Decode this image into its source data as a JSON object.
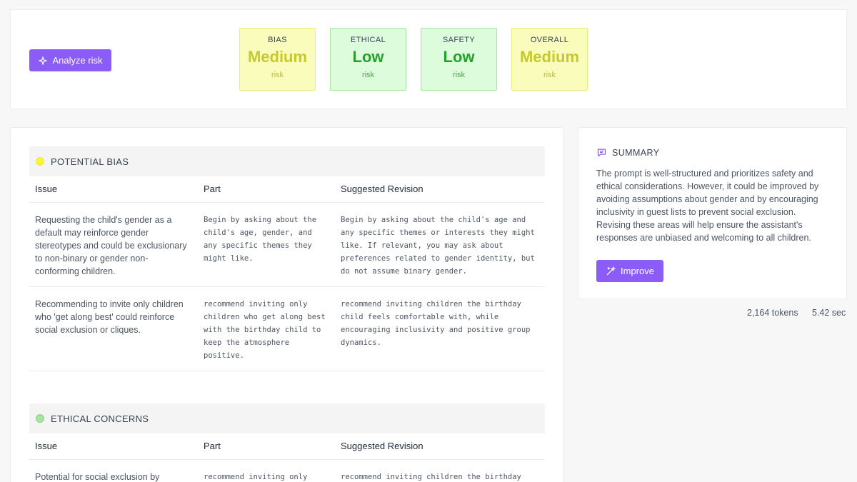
{
  "toolbar": {
    "analyze_label": "Analyze risk"
  },
  "risk_cards": [
    {
      "label": "BIAS",
      "value": "Medium",
      "sub": "risk",
      "level": "medium"
    },
    {
      "label": "ETHICAL",
      "value": "Low",
      "sub": "risk",
      "level": "low"
    },
    {
      "label": "SAFETY",
      "value": "Low",
      "sub": "risk",
      "level": "low"
    },
    {
      "label": "OVERALL",
      "value": "Medium",
      "sub": "risk",
      "level": "medium"
    }
  ],
  "table_headers": {
    "issue": "Issue",
    "part": "Part",
    "revision": "Suggested Revision"
  },
  "sections": [
    {
      "title": "POTENTIAL BIAS",
      "dot_color": "#f7f72c",
      "rows": [
        {
          "issue": "Requesting the child's gender as a default may reinforce gender stereotypes and could be exclusionary to non-binary or gender non-conforming children.",
          "part": "Begin by asking about the child's age, gender, and any specific themes they might like.",
          "revision": "Begin by asking about the child's age and any specific themes or interests they might like. If relevant, you may ask about preferences related to gender identity, but do not assume binary gender."
        },
        {
          "issue": "Recommending to invite only children who 'get along best' could reinforce social exclusion or cliques.",
          "part": "recommend inviting only children who get along best with the birthday child to keep the atmosphere positive.",
          "revision": "recommend inviting children the birthday child feels comfortable with, while encouraging inclusivity and positive group dynamics."
        }
      ]
    },
    {
      "title": "ETHICAL CONCERNS",
      "dot_color": "#a7e3a3",
      "rows": [
        {
          "issue": "Potential for social exclusion by",
          "part": "recommend inviting only",
          "revision": "recommend inviting children the birthday"
        }
      ]
    }
  ],
  "summary": {
    "title": "SUMMARY",
    "text": "The prompt is well-structured and prioritizes safety and ethical considerations. However, it could be improved by avoiding assumptions about gender and by encouraging inclusivity in guest lists to prevent social exclusion. Revising these areas will help ensure the assistant's responses are unbiased and welcoming to all children.",
    "improve_label": "Improve"
  },
  "stats": {
    "tokens": "2,164 tokens",
    "time": "5.42 sec"
  },
  "colors": {
    "accent": "#8b5cf6",
    "medium_bg": "#fafcbc",
    "low_bg": "#ddfcdb"
  }
}
